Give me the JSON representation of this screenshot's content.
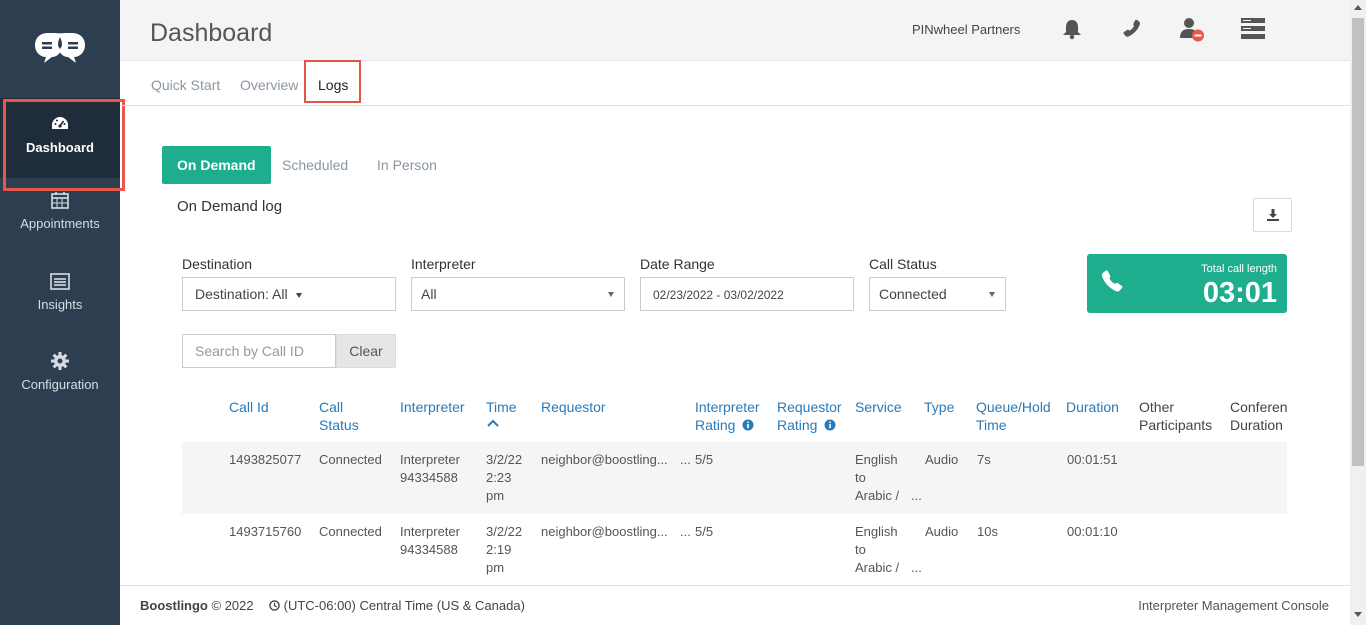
{
  "header": {
    "title": "Dashboard",
    "org_name": "PINwheel Partners"
  },
  "sidebar": {
    "items": [
      {
        "label": "Dashboard",
        "icon": "speedometer-icon"
      },
      {
        "label": "Appointments",
        "icon": "calendar-icon"
      },
      {
        "label": "Insights",
        "icon": "list-icon"
      },
      {
        "label": "Configuration",
        "icon": "gear-icon"
      }
    ]
  },
  "tabs": [
    "Quick Start",
    "Overview",
    "Logs"
  ],
  "subtabs": [
    "On Demand",
    "Scheduled",
    "In Person"
  ],
  "section_title": "On Demand log",
  "filters": {
    "destination": {
      "label": "Destination",
      "value": "Destination: All"
    },
    "interpreter": {
      "label": "Interpreter",
      "value": "All"
    },
    "date_range": {
      "label": "Date Range",
      "value": "02/23/2022 - 03/02/2022"
    },
    "call_status": {
      "label": "Call Status",
      "value": "Connected"
    }
  },
  "total_call": {
    "label": "Total call length",
    "value": "03:01"
  },
  "search": {
    "placeholder": "Search by Call ID",
    "clear_label": "Clear"
  },
  "table": {
    "headers": {
      "call_id": "Call Id",
      "call_status": [
        "Call",
        "Status"
      ],
      "interpreter": "Interpreter",
      "time": "Time",
      "requestor": "Requestor",
      "interpreter_rating": [
        "Interpreter",
        "Rating"
      ],
      "requestor_rating": [
        "Requestor",
        "Rating"
      ],
      "service": "Service",
      "type": "Type",
      "queue_hold": [
        "Queue/Hold",
        "Time"
      ],
      "duration": "Duration",
      "other_participants": [
        "Other",
        "Participants"
      ],
      "conference_duration": [
        "Conferen",
        "Duration"
      ]
    },
    "rows": [
      {
        "call_id": "1493825077",
        "call_status": "Connected",
        "interpreter": [
          "Interpreter",
          "94334588"
        ],
        "time": [
          "3/2/22",
          "2:23",
          "pm"
        ],
        "requestor": "neighbor@boostling...",
        "interpreter_rating": "5/5",
        "service": [
          "English",
          "to",
          "Arabic /"
        ],
        "type": "Audio",
        "queue_hold": "7s",
        "duration": "00:01:51"
      },
      {
        "call_id": "1493715760",
        "call_status": "Connected",
        "interpreter": [
          "Interpreter",
          "94334588"
        ],
        "time": [
          "3/2/22",
          "2:19",
          "pm"
        ],
        "requestor": "neighbor@boostling...",
        "interpreter_rating": "5/5",
        "service": [
          "English",
          "to",
          "Arabic /"
        ],
        "type": "Audio",
        "queue_hold": "10s",
        "duration": "00:01:10"
      }
    ],
    "ellipsis": "..."
  },
  "footer": {
    "brand": "Boostlingo",
    "copyright": "© 2022",
    "timezone": "(UTC-06:00) Central Time (US & Canada)",
    "console": "Interpreter Management Console"
  },
  "colors": {
    "sidebar": "#2d3e50",
    "accent": "#1fae8d",
    "link": "#2a7ab8",
    "highlight": "#e0574a"
  }
}
